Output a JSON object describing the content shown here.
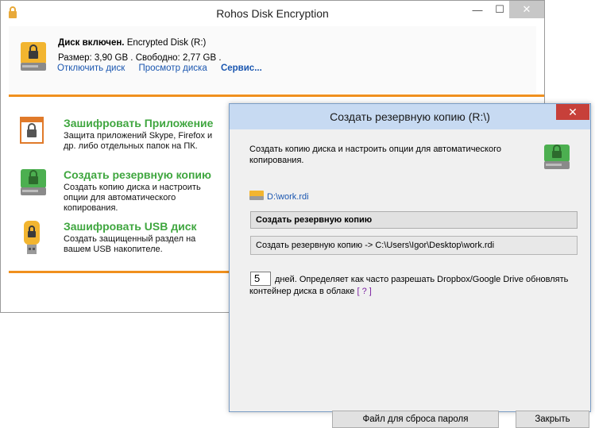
{
  "main_window": {
    "title": "Rohos Disk Encryption",
    "controls": {
      "minimize": "—",
      "maximize": "☐",
      "close": "✕"
    }
  },
  "disk": {
    "status_bold": "Диск включен.",
    "status_rest": "Encrypted Disk (R:)",
    "size_info": "Размер: 3,90 GB .  Свободно: 2,77 GB .",
    "links": [
      "Отключить диск",
      "Просмотр диска",
      "Сервис..."
    ]
  },
  "menu": [
    {
      "title": "Зашифровать Приложение",
      "desc": "Защита приложений Skype, Firefox и др. либо отдельных папок на ПК."
    },
    {
      "title": "Создать резервную копию",
      "desc": "Создать копию диска и настроить опции для автоматического копирования."
    },
    {
      "title": "Зашифровать USB диск",
      "desc": "Создать защищенный раздел на вашем USB накопителе."
    }
  ],
  "dialog": {
    "title": "Создать резервную копию (R:\\)",
    "close": "✕",
    "description": "Создать копию диска и настроить опции для автоматического копирования.",
    "file_path": "D:\\work.rdi",
    "backup_button": "Создать резервную копию",
    "status": "Создать резервную копию -> C:\\Users\\Igor\\Desktop\\work.rdi",
    "days_value": "5",
    "days_text": "дней. Определяет как часто разрешать Dropbox/Google Drive обновлять контейнер диска в облаке",
    "help_link": "[ ? ]",
    "reset_button": "Файл для сброса пароля",
    "close_button": "Закрыть"
  },
  "colors": {
    "accent_orange": "#f0901e",
    "menu_green": "#3fa63f",
    "link_blue": "#1a56b0"
  }
}
